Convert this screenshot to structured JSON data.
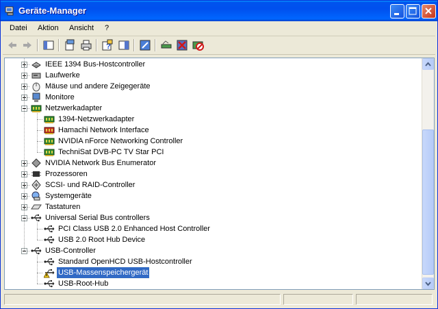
{
  "window": {
    "title": "Geräte-Manager"
  },
  "menu": [
    "Datei",
    "Aktion",
    "Ansicht",
    "?"
  ],
  "toolbar_icons": [
    "back-icon",
    "forward-icon",
    "show-hide-tree-icon",
    "properties-icon",
    "print-icon",
    "help-icon",
    "action-pane-icon",
    "update-driver-icon",
    "scan-hardware-icon",
    "uninstall-icon",
    "disable-icon"
  ],
  "tree": [
    {
      "label": "IEEE 1394 Bus-Hostcontroller",
      "level": 0,
      "state": "collapsed",
      "icon": "firewire-icon"
    },
    {
      "label": "Laufwerke",
      "level": 0,
      "state": "collapsed",
      "icon": "disk-drive-icon"
    },
    {
      "label": "Mäuse und andere Zeigegeräte",
      "level": 0,
      "state": "collapsed",
      "icon": "mouse-icon"
    },
    {
      "label": "Monitore",
      "level": 0,
      "state": "collapsed",
      "icon": "monitor-icon"
    },
    {
      "label": "Netzwerkadapter",
      "level": 0,
      "state": "expanded",
      "icon": "network-card-icon"
    },
    {
      "label": "1394-Netzwerkadapter",
      "level": 1,
      "icon": "network-card-icon"
    },
    {
      "label": "Hamachi Network Interface",
      "level": 1,
      "icon": "network-card-red-icon"
    },
    {
      "label": "NVIDIA nForce Networking Controller",
      "level": 1,
      "icon": "network-card-icon"
    },
    {
      "label": "TechniSat DVB-PC TV Star PCI",
      "level": 1,
      "icon": "network-card-icon"
    },
    {
      "label": "NVIDIA Network Bus Enumerator",
      "level": 0,
      "state": "collapsed",
      "icon": "bus-enumerator-icon"
    },
    {
      "label": "Prozessoren",
      "level": 0,
      "state": "collapsed",
      "icon": "processor-icon"
    },
    {
      "label": "SCSI- und RAID-Controller",
      "level": 0,
      "state": "collapsed",
      "icon": "scsi-icon"
    },
    {
      "label": "Systemgeräte",
      "level": 0,
      "state": "collapsed",
      "icon": "system-device-icon"
    },
    {
      "label": "Tastaturen",
      "level": 0,
      "state": "collapsed",
      "icon": "keyboard-icon"
    },
    {
      "label": "Universal Serial Bus controllers",
      "level": 0,
      "state": "expanded",
      "icon": "usb-icon"
    },
    {
      "label": "PCI Class USB 2.0 Enhanced Host Controller",
      "level": 1,
      "icon": "usb-icon"
    },
    {
      "label": "USB 2.0 Root Hub Device",
      "level": 1,
      "icon": "usb-icon"
    },
    {
      "label": "USB-Controller",
      "level": 0,
      "state": "expanded",
      "icon": "usb-icon"
    },
    {
      "label": "Standard OpenHCD USB-Hostcontroller",
      "level": 1,
      "icon": "usb-icon"
    },
    {
      "label": "USB-Massenspeichergerät",
      "level": 1,
      "icon": "usb-warning-icon",
      "selected": true
    },
    {
      "label": "USB-Root-Hub",
      "level": 1,
      "icon": "usb-icon"
    }
  ],
  "colors": {
    "titlebar": "#0054e3",
    "selection": "#316ac5",
    "window_bg": "#ece9d8"
  }
}
